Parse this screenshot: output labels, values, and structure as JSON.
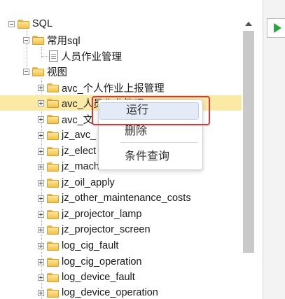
{
  "tree": {
    "root": "SQL",
    "common_folder": "常用sql",
    "common_item": "人员作业管理",
    "view_folder": "视图",
    "views": [
      "avc_个人作业上报管理",
      "avc_人员作业管理",
      "avc_文",
      "jz_avc_",
      "jz_elect",
      "jz_mach",
      "jz_oil_apply",
      "jz_other_maintenance_costs",
      "jz_projector_lamp",
      "jz_projector_screen",
      "log_cig_fault",
      "log_cig_operation",
      "log_device_fault",
      "log_device_operation"
    ]
  },
  "context_menu": {
    "run": "运行",
    "delete": "删除",
    "condition_query": "条件查询"
  },
  "colors": {
    "selection": "#fbe9a6",
    "highlight_box": "#e53232",
    "run_icon": "#2aa640"
  }
}
